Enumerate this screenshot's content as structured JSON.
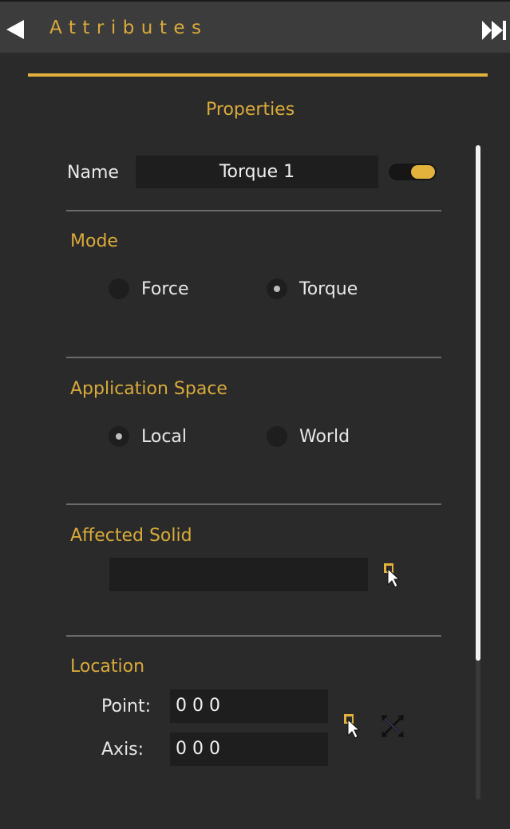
{
  "header": {
    "title": "Attributes"
  },
  "properties": {
    "title": "Properties",
    "name_label": "Name",
    "name_value": "Torque 1",
    "enabled": true
  },
  "mode": {
    "title": "Mode",
    "options": [
      "Force",
      "Torque"
    ],
    "selected": "Torque"
  },
  "application_space": {
    "title": "Application Space",
    "options": [
      "Local",
      "World"
    ],
    "selected": "Local"
  },
  "affected_solid": {
    "title": "Affected Solid",
    "value": ""
  },
  "location": {
    "title": "Location",
    "point_label": "Point:",
    "point_value": "0 0 0",
    "axis_label": "Axis:",
    "axis_value": "0 0 0"
  },
  "icons": {
    "collapse": "left-arrow-icon",
    "expand": "double-right-arrow-icon",
    "pick": "pick-cursor-icon",
    "clear": "cross-arrows-icon"
  },
  "colors": {
    "accent": "#e3b23c",
    "background": "#2a2a2a",
    "field": "#1e1e1e"
  }
}
